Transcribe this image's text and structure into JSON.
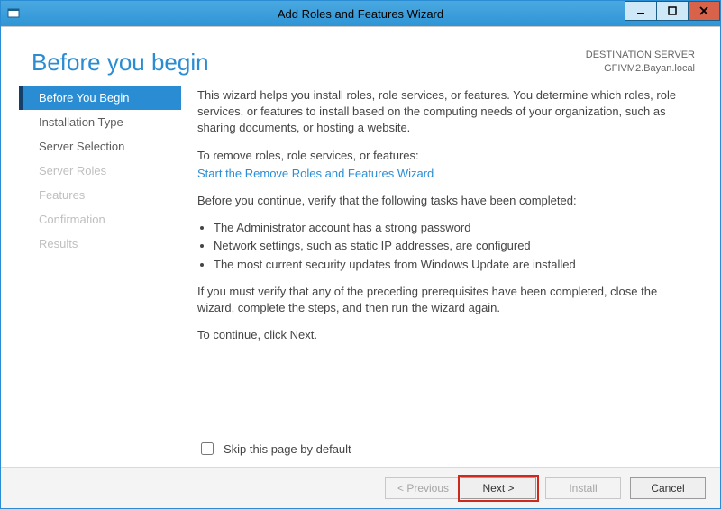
{
  "window": {
    "title": "Add Roles and Features Wizard"
  },
  "header": {
    "page_title": "Before you begin",
    "dest_label": "DESTINATION SERVER",
    "dest_value": "GFIVM2.Bayan.local"
  },
  "sidebar": {
    "items": [
      {
        "label": "Before You Begin",
        "state": "selected"
      },
      {
        "label": "Installation Type",
        "state": "enabled"
      },
      {
        "label": "Server Selection",
        "state": "enabled"
      },
      {
        "label": "Server Roles",
        "state": "disabled"
      },
      {
        "label": "Features",
        "state": "disabled"
      },
      {
        "label": "Confirmation",
        "state": "disabled"
      },
      {
        "label": "Results",
        "state": "disabled"
      }
    ]
  },
  "content": {
    "intro": "This wizard helps you install roles, role services, or features. You determine which roles, role services, or features to install based on the computing needs of your organization, such as sharing documents, or hosting a website.",
    "remove_label": "To remove roles, role services, or features:",
    "remove_link": "Start the Remove Roles and Features Wizard",
    "verify_label": "Before you continue, verify that the following tasks have been completed:",
    "bullets": [
      "The Administrator account has a strong password",
      "Network settings, such as static IP addresses, are configured",
      "The most current security updates from Windows Update are installed"
    ],
    "prereq_note": "If you must verify that any of the preceding prerequisites have been completed, close the wizard, complete the steps, and then run the wizard again.",
    "continue_note": "To continue, click Next.",
    "skip_label": "Skip this page by default"
  },
  "footer": {
    "previous": "< Previous",
    "next": "Next >",
    "install": "Install",
    "cancel": "Cancel"
  }
}
